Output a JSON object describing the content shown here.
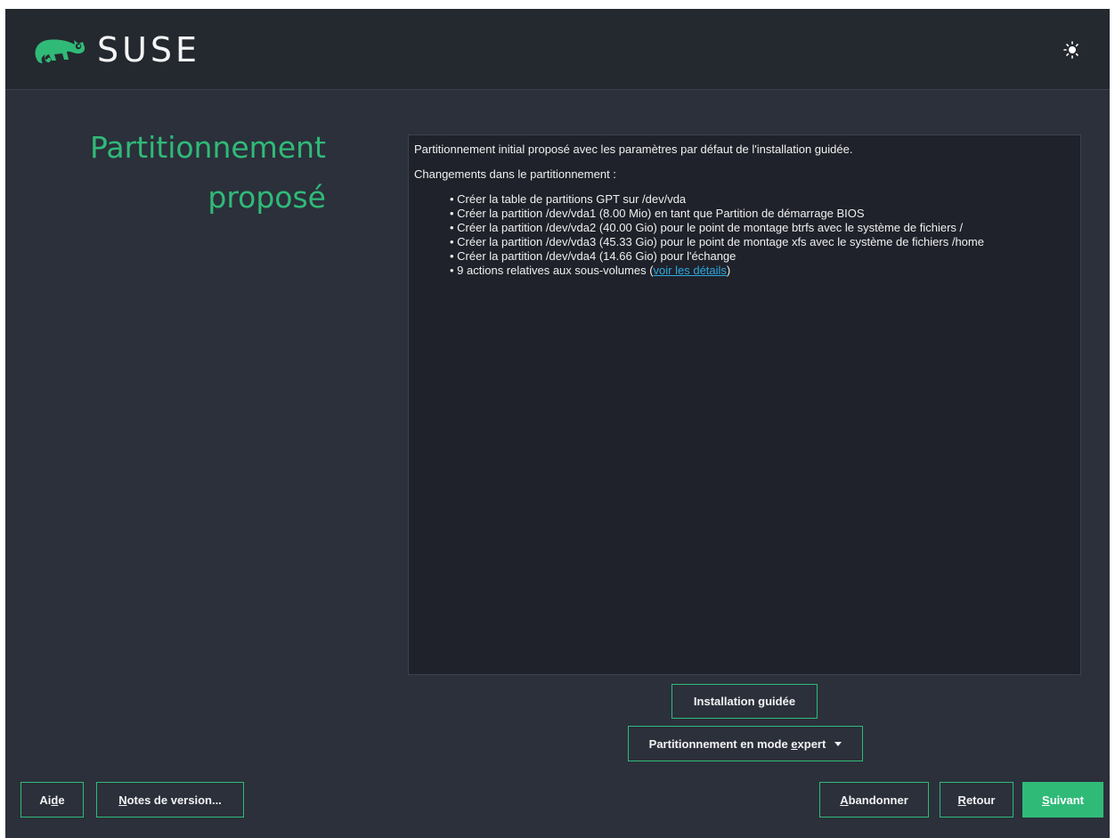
{
  "app": {
    "brand": "SUSE",
    "brand_color": "#30ba78",
    "logo_icon": "suse-chameleon-icon",
    "theme_icon": "theme-toggle-icon"
  },
  "page": {
    "title_line1": "Partitionnement",
    "title_line2": "proposé"
  },
  "proposal": {
    "intro": "Partitionnement initial proposé avec les paramètres par défaut de l'installation guidée.",
    "changes_heading": "Changements dans le partitionnement :",
    "items": [
      "• Créer la table de partitions GPT sur /dev/vda",
      "• Créer la partition /dev/vda1 (8.00 Mio) en tant que Partition de démarrage BIOS",
      "• Créer la partition /dev/vda2 (40.00 Gio) pour le point de montage btrfs avec le système de fichiers /",
      "• Créer la partition /dev/vda3 (45.33 Gio) pour le point de montage xfs avec le système de fichiers /home",
      "• Créer la partition /dev/vda4 (14.66 Gio) pour l'échange"
    ],
    "subvolumes_prefix": "• 9 actions relatives aux sous-volumes (",
    "subvolumes_link": "voir les détails",
    "subvolumes_suffix": ")"
  },
  "buttons": {
    "guided": {
      "before": "Installation ",
      "mnemonic": "g",
      "after": "uidée"
    },
    "expert": {
      "before": "Partitionnement en mode ",
      "mnemonic": "e",
      "after": "xpert"
    },
    "help": {
      "before": "Ai",
      "mnemonic": "d",
      "after": "e"
    },
    "notes": {
      "before": "",
      "mnemonic": "N",
      "after": "otes de version..."
    },
    "abort": {
      "before": "",
      "mnemonic": "A",
      "after": "bandonner"
    },
    "back": {
      "before": "",
      "mnemonic": "R",
      "after": "etour"
    },
    "next": {
      "before": "",
      "mnemonic": "S",
      "after": "uivant"
    }
  }
}
